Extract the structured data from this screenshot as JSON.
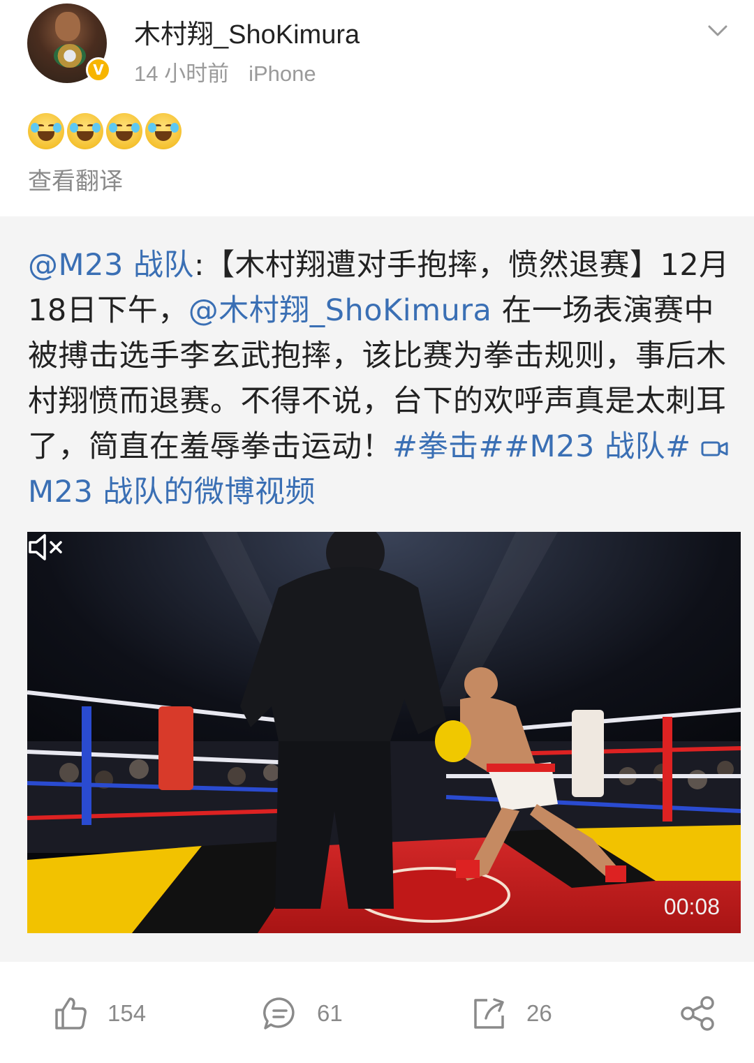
{
  "post": {
    "username": "木村翔_ShoKimura",
    "time": "14 小时前",
    "device": "iPhone",
    "verified_badge": "V",
    "emoji_icon": "laugh-cry-emoji",
    "emoji_count": 4,
    "translate_label": "查看翻译"
  },
  "repost": {
    "mention_source": "@M23 战队",
    "text_1": ":【木村翔遭对手抱摔，愤然退赛】12月18日下午，",
    "mention_user": "@木村翔_ShoKimura",
    "text_2": " 在一场表演赛中被搏击选手李玄武抱摔，该比赛为拳击规则，事后木村翔愤而退赛。不得不说，台下的欢呼声真是太刺耳了，简直在羞辱拳击运动！",
    "hashtag_1": "#拳击#",
    "hashtag_2": "#M23 战队#",
    "video_link": "M23 战队的微博视频",
    "video": {
      "duration": "00:08",
      "muted": true
    }
  },
  "actions": {
    "like_count": "154",
    "comment_count": "61",
    "repost_count": "26"
  },
  "colors": {
    "link": "#3a6fb4",
    "muted_text": "#9a9a9a",
    "repost_bg": "#f4f4f4",
    "badge": "#f7b500"
  }
}
